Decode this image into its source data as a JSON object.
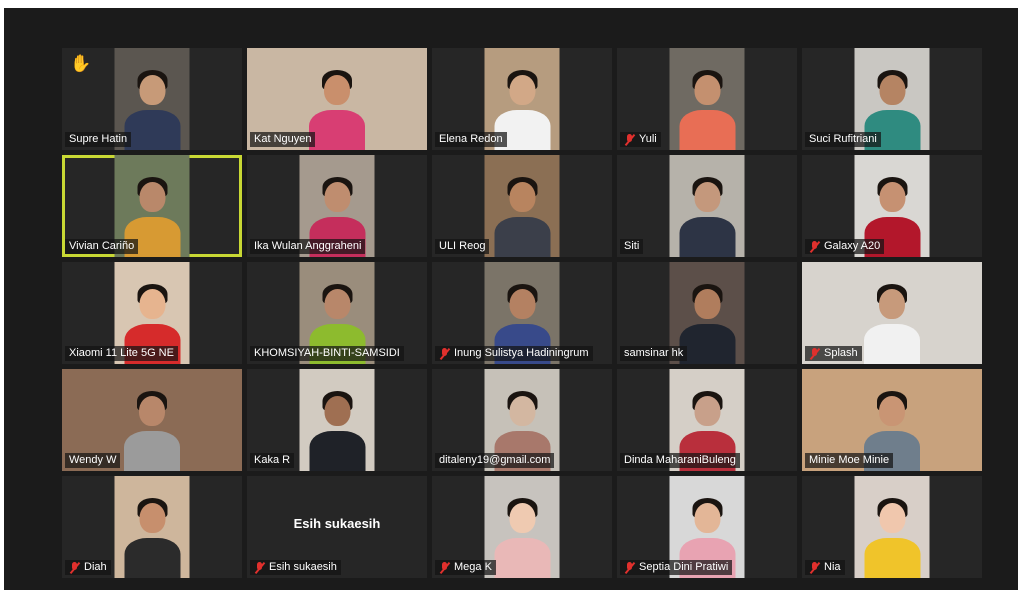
{
  "participants": [
    {
      "name": "Supre Hatin",
      "muted": false,
      "hand_raised": true,
      "video": true,
      "bg": "#5b5650",
      "skin": "#c79a78",
      "shirt": "#2f3a58"
    },
    {
      "name": "Kat Nguyen",
      "muted": false,
      "hand_raised": false,
      "video": true,
      "wide": true,
      "bg": "#c9b7a3",
      "skin": "#c98f6c",
      "shirt": "#d83e73"
    },
    {
      "name": "Elena Redon",
      "muted": false,
      "hand_raised": false,
      "video": true,
      "bg": "#b69c7f",
      "skin": "#d2a887",
      "shirt": "#f2f2f2"
    },
    {
      "name": "Yuli",
      "muted": true,
      "hand_raised": false,
      "video": true,
      "bg": "#6f6a62",
      "skin": "#c4906f",
      "shirt": "#e86e55"
    },
    {
      "name": "Suci Rufitriani",
      "muted": false,
      "hand_raised": false,
      "video": true,
      "bg": "#c9c7c2",
      "skin": "#b58463",
      "shirt": "#2f8b80"
    },
    {
      "name": "Vivian Cariño",
      "muted": false,
      "hand_raised": false,
      "video": true,
      "active": true,
      "bg": "#6d7a5b",
      "skin": "#b9886a",
      "shirt": "#d79a33"
    },
    {
      "name": "Ika Wulan Anggraheni",
      "muted": false,
      "hand_raised": false,
      "video": true,
      "bg": "#a59a8e",
      "skin": "#bf8d6f",
      "shirt": "#c52e5c"
    },
    {
      "name": "ULI Reog",
      "muted": false,
      "hand_raised": false,
      "video": true,
      "bg": "#8b6f54",
      "skin": "#b8845f",
      "shirt": "#3b3f4a"
    },
    {
      "name": "Siti",
      "muted": false,
      "hand_raised": false,
      "video": true,
      "bg": "#b6b2aa",
      "skin": "#c4987c",
      "shirt": "#2d3445"
    },
    {
      "name": "Galaxy A20",
      "muted": true,
      "hand_raised": false,
      "video": true,
      "bg": "#d9d7d3",
      "skin": "#c69172",
      "shirt": "#b3172b"
    },
    {
      "name": "Xiaomi 11 Lite 5G NE",
      "muted": false,
      "hand_raised": false,
      "video": true,
      "bg": "#d8c6b2",
      "skin": "#e6b48f",
      "shirt": "#d62b2b"
    },
    {
      "name": "KHOMSIYAH-BINTI-SAMSIDI",
      "muted": false,
      "hand_raised": false,
      "video": true,
      "bg": "#9a8d7c",
      "skin": "#b8876a",
      "shirt": "#8dbb2e"
    },
    {
      "name": "Inung Sulistya Hadiningrum",
      "muted": true,
      "hand_raised": false,
      "video": true,
      "bg": "#7b7468",
      "skin": "#b48162",
      "shirt": "#384a8a"
    },
    {
      "name": "samsinar hk",
      "muted": false,
      "hand_raised": false,
      "video": true,
      "bg": "#5c4f49",
      "skin": "#b07d5d",
      "shirt": "#20252f"
    },
    {
      "name": "Splash",
      "muted": true,
      "hand_raised": false,
      "video": true,
      "wide": true,
      "bg": "#d7d3cd",
      "skin": "#c79a7b",
      "shirt": "#f1f1f1"
    },
    {
      "name": "Wendy W",
      "muted": false,
      "hand_raised": false,
      "video": true,
      "wide": true,
      "bg": "#8b6b55",
      "skin": "#b8876a",
      "shirt": "#9b9b9b"
    },
    {
      "name": "Kaka R",
      "muted": false,
      "hand_raised": false,
      "video": true,
      "bg": "#d2cbc1",
      "skin": "#9f6f52",
      "shirt": "#1f2228"
    },
    {
      "name": "ditaleny19@gmail.com",
      "muted": false,
      "hand_raised": false,
      "video": true,
      "bg": "#c6c1b8",
      "skin": "#d3b7a1",
      "shirt": "#a8786b"
    },
    {
      "name": "Dinda MaharaniBuleng",
      "muted": false,
      "hand_raised": false,
      "video": true,
      "bg": "#d5cfc7",
      "skin": "#c8a08a",
      "shirt": "#b92f3c"
    },
    {
      "name": "Minie Moe Minie",
      "muted": false,
      "hand_raised": false,
      "video": true,
      "wide": true,
      "bg": "#c8a27d",
      "skin": "#c99574",
      "shirt": "#6f7e8c"
    },
    {
      "name": "Diah",
      "muted": true,
      "hand_raised": false,
      "video": true,
      "bg": "#ceb69c",
      "skin": "#c78f6d",
      "shirt": "#2b2b2b"
    },
    {
      "name": "Esih sukaesih",
      "muted": true,
      "hand_raised": false,
      "video": false,
      "center_label": "Esih sukaesih"
    },
    {
      "name": "Mega K",
      "muted": true,
      "hand_raised": false,
      "video": true,
      "bg": "#c7c3be",
      "skin": "#efcab1",
      "shirt": "#e9b8b7"
    },
    {
      "name": "Septia Dini Pratiwi",
      "muted": true,
      "hand_raised": false,
      "video": true,
      "bg": "#d8d8d8",
      "skin": "#e3b697",
      "shirt": "#e8a3b2"
    },
    {
      "name": "Nia",
      "muted": true,
      "hand_raised": false,
      "video": true,
      "bg": "#d8cfc8",
      "skin": "#f0c7ad",
      "shirt": "#f0c42a"
    }
  ],
  "colors": {
    "background": "#1b1b1b",
    "tile": "#262626",
    "active_border": "#c8d834",
    "muted_icon": "#e0302d",
    "hand_icon": "#f3c230"
  }
}
